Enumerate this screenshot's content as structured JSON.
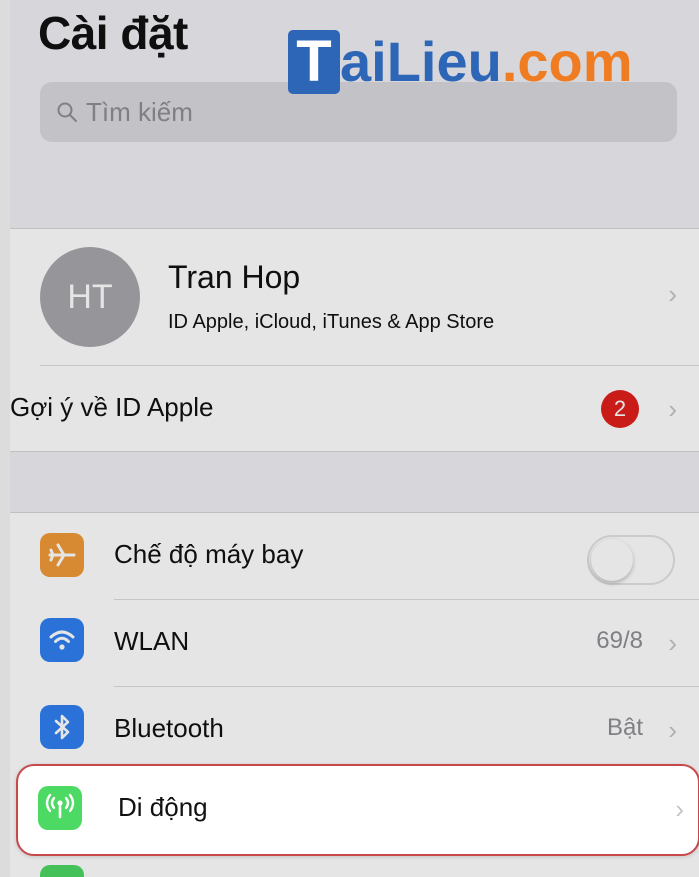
{
  "header": {
    "title": "Cài đặt"
  },
  "watermark": {
    "logo_letter": "T",
    "text_blue": "aiLieu",
    "text_orange": ".com"
  },
  "search": {
    "placeholder": "Tìm kiếm",
    "icon": "search-icon"
  },
  "profile": {
    "initials": "HT",
    "name": "Tran Hop",
    "subtitle": "ID Apple, iCloud, iTunes & App Store",
    "chevron": "›"
  },
  "apple_id_suggestion": {
    "label": "Gợi ý về ID Apple",
    "badge": "2",
    "chevron": "›"
  },
  "settings": {
    "airplane": {
      "label": "Chế độ máy bay",
      "icon": "airplane-icon",
      "color": "#f09a37",
      "toggle_on": false
    },
    "wlan": {
      "label": "WLAN",
      "value": "69/8",
      "icon": "wifi-icon",
      "color": "#2f7ff0",
      "chevron": "›"
    },
    "bluetooth": {
      "label": "Bluetooth",
      "value": "Bật",
      "icon": "bluetooth-icon",
      "color": "#2f7ff0",
      "chevron": "›"
    },
    "cellular": {
      "label": "Di động",
      "icon": "cellular-antenna-icon",
      "color": "#4cd964",
      "chevron": "›"
    }
  },
  "colors": {
    "badge": "#e0201c",
    "highlight_border": "#c8494a"
  }
}
